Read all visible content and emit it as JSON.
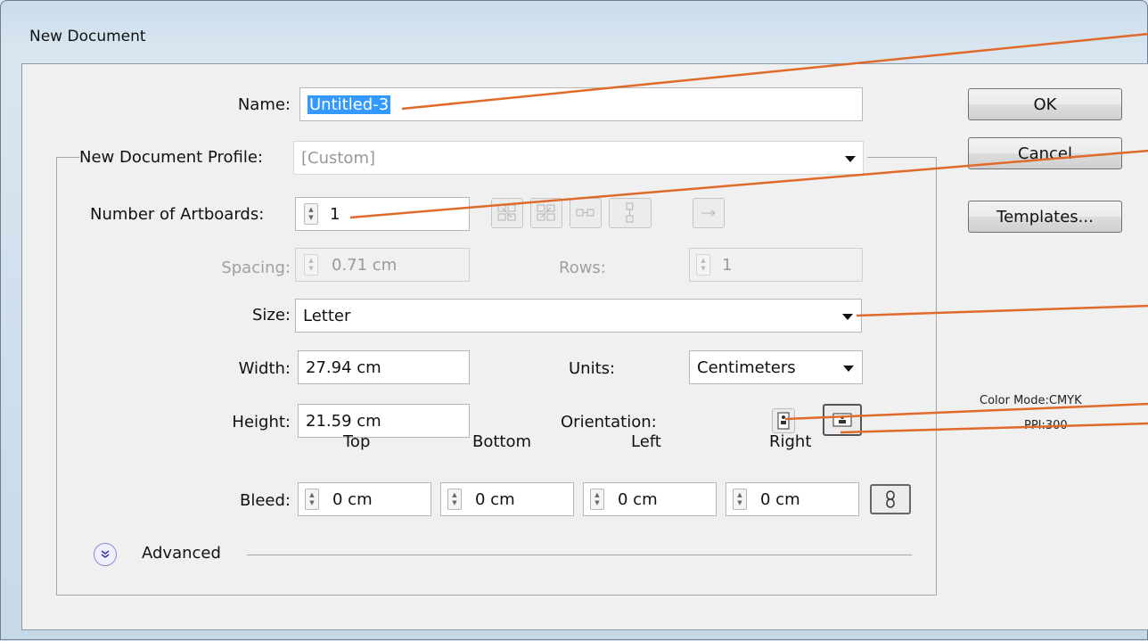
{
  "window": {
    "title": "New Document"
  },
  "form": {
    "name_label": "Name:",
    "name_value": "Untitled-3",
    "profile_label": "New Document Profile:",
    "profile_value": "[Custom]",
    "artboards_label": "Number of Artboards:",
    "artboards_value": "1",
    "spacing_label": "Spacing:",
    "spacing_value": "0.71 cm",
    "rows_label": "Rows:",
    "rows_value": "1",
    "size_label": "Size:",
    "size_value": "Letter",
    "width_label": "Width:",
    "width_value": "27.94 cm",
    "units_label": "Units:",
    "units_value": "Centimeters",
    "height_label": "Height:",
    "height_value": "21.59 cm",
    "orientation_label": "Orientation:",
    "bleed_label": "Bleed:",
    "bleed": {
      "top_label": "Top",
      "top_value": "0 cm",
      "bottom_label": "Bottom",
      "bottom_value": "0 cm",
      "left_label": "Left",
      "left_value": "0 cm",
      "right_label": "Right",
      "right_value": "0 cm"
    },
    "advanced_label": "Advanced"
  },
  "buttons": {
    "ok": "OK",
    "cancel": "Cancel",
    "templates": "Templates..."
  },
  "info": {
    "color_mode": "Color Mode:CMYK",
    "ppi": "PPI:300"
  },
  "icons": {
    "spinner": "spinner-arrows-icon",
    "grid_by_row": "grid-by-row-icon",
    "grid_by_column": "grid-by-column-icon",
    "arrange_by_row": "arrange-by-row-icon",
    "arrange_by_column": "arrange-by-column-icon",
    "rtl_layout": "right-to-left-arrow-icon",
    "portrait": "portrait-orientation-icon",
    "landscape": "landscape-orientation-icon",
    "link": "chain-link-icon",
    "advanced_toggle": "chevron-double-down-icon"
  },
  "colors": {
    "annotation_line": "#e06a2a",
    "accent_selection": "#3399ff"
  }
}
